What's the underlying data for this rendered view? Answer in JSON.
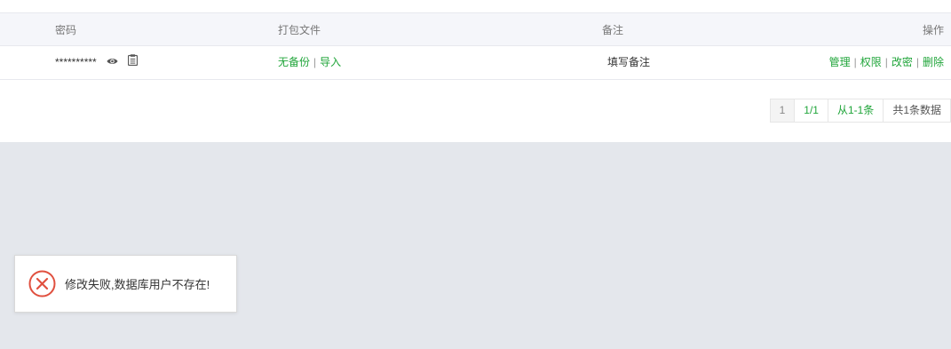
{
  "table": {
    "headers": {
      "password": "密码",
      "package_file": "打包文件",
      "remark": "备注",
      "actions": "操作"
    },
    "row": {
      "password_mask": "**********",
      "backup_status": "无备份",
      "import_label": "导入",
      "remark_placeholder": "填写备注",
      "actions": {
        "manage": "管理",
        "permission": "权限",
        "change_password": "改密",
        "delete": "删除"
      },
      "separator": "|"
    }
  },
  "pagination": {
    "current_page": "1",
    "page_of": "1/1",
    "range": "从1-1条",
    "total": "共1条数据"
  },
  "toast": {
    "message": "修改失败,数据库用户不存在!",
    "icon": "error-circle-icon",
    "icon_color": "#e0503f"
  },
  "colors": {
    "link": "#20a53a",
    "header_bg": "#f5f6fa",
    "page_bg": "#e4e7ec"
  },
  "icons": {
    "show_password": "eye-icon",
    "copy_password": "clipboard-icon"
  }
}
